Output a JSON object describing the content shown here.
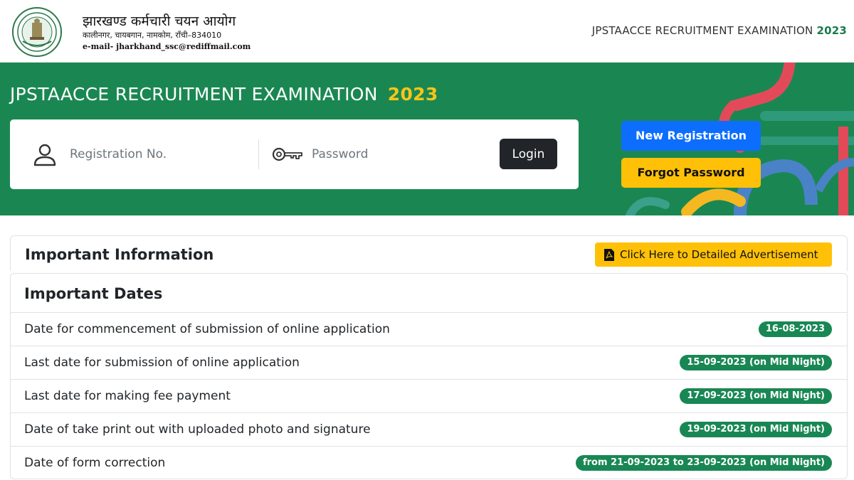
{
  "header": {
    "org_name": "झारखण्ड कर्मचारी चयन आयोग",
    "org_address": "कालीनगर, चायबगान, नामकोम, राँची–834010",
    "org_email": "e-mail- jharkhand_ssc@rediffmail.com",
    "exam_title": "JPSTAACCE RECRUITMENT EXAMINATION",
    "exam_year": "2023"
  },
  "banner": {
    "title": "JPSTAACCE RECRUITMENT EXAMINATION",
    "year": "2023",
    "login": {
      "registration_placeholder": "Registration No.",
      "password_placeholder": "Password",
      "login_label": "Login"
    },
    "new_registration_label": "New Registration",
    "forgot_password_label": "Forgot Password"
  },
  "important_information": {
    "title": "Important Information",
    "advertisement_label": "Click Here to Detailed Advertisement"
  },
  "important_dates": {
    "title": "Important Dates",
    "rows": [
      {
        "label": "Date for commencement of submission of online application",
        "date": "16-08-2023"
      },
      {
        "label": "Last date for submission of online application",
        "date": "15-09-2023 (on Mid Night)"
      },
      {
        "label": "Last date for making fee payment",
        "date": "17-09-2023 (on Mid Night)"
      },
      {
        "label": "Date of take print out with uploaded photo and signature",
        "date": "19-09-2023 (on Mid Night)"
      },
      {
        "label": "Date of form correction",
        "date": "from 21-09-2023 to 23-09-2023 (on Mid Night)"
      }
    ]
  },
  "colors": {
    "banner_green": "#1a8752",
    "badge_green": "#198754",
    "year_yellow": "#f5c518",
    "primary_blue": "#0d6efd",
    "warning_yellow": "#ffc107",
    "dark_button": "#212529"
  },
  "icons": [
    "emblem-logo",
    "user-icon",
    "key-icon",
    "pdf-icon"
  ]
}
